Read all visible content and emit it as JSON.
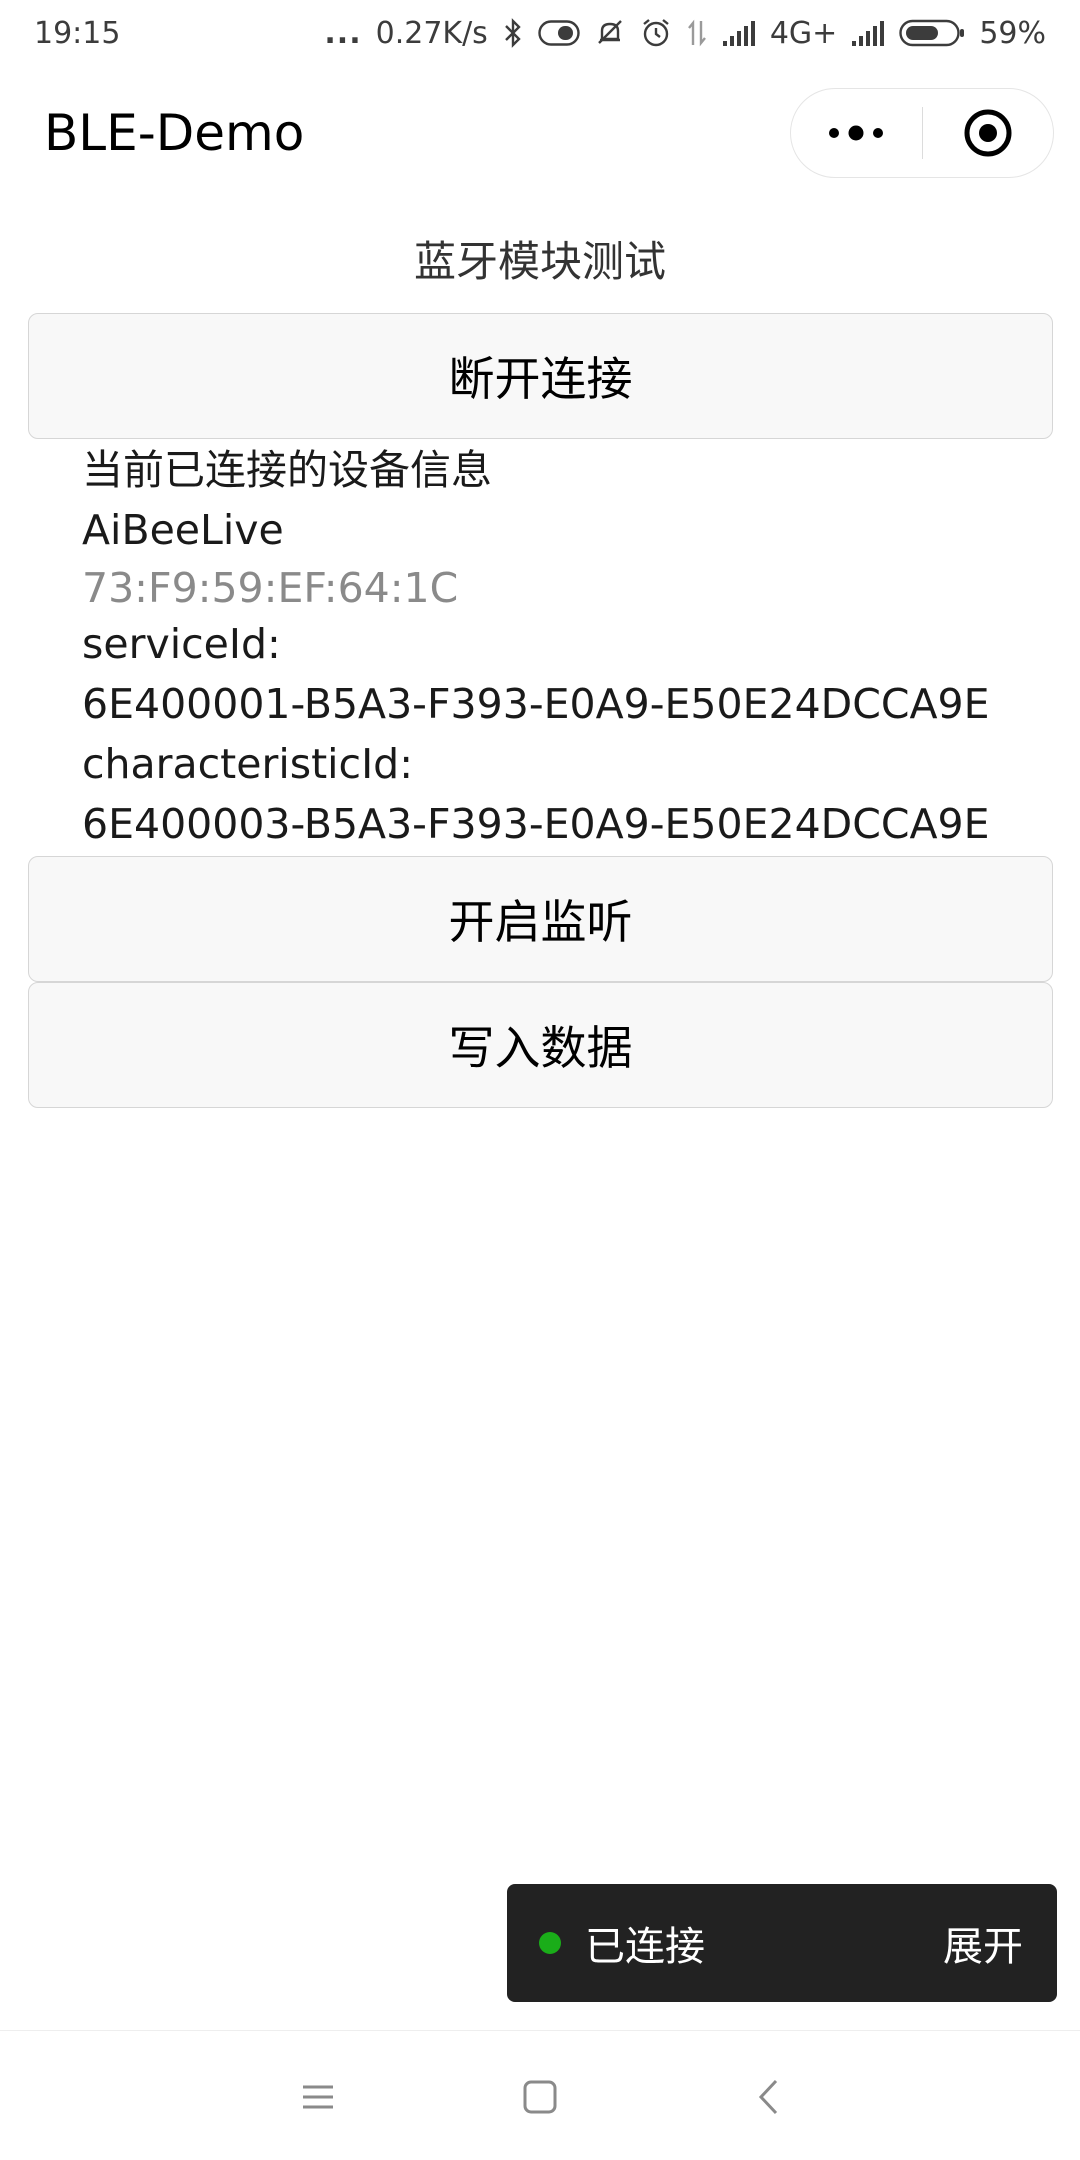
{
  "status_bar": {
    "time": "19:15",
    "more": "...",
    "net_speed": "0.27K/s",
    "network": "4G+",
    "battery": "59%",
    "icons": [
      "bluetooth-icon",
      "toggle-icon",
      "mute-icon",
      "alarm-icon",
      "data-transfer-icon",
      "signal-icon",
      "signal-icon",
      "battery-icon"
    ]
  },
  "nav": {
    "title": "BLE-Demo",
    "menu_icon": "more-dots-icon",
    "close_icon": "target-circle-icon"
  },
  "page": {
    "heading": "蓝牙模块测试",
    "disconnect_label": "断开连接",
    "listen_label": "开启监听",
    "write_label": "写入数据"
  },
  "device_info": {
    "title": "当前已连接的设备信息",
    "name": "AiBeeLive",
    "mac": "73:F9:59:EF:64:1C",
    "service_label": "serviceId:",
    "service_id": "6E400001-B5A3-F393-E0A9-E50E24DCCA9E",
    "characteristic_label": "characteristicId:",
    "characteristic_id": "6E400003-B5A3-F393-E0A9-E50E24DCCA9E"
  },
  "toast": {
    "status": "已连接",
    "action": "展开",
    "dot_color": "#1aad19"
  },
  "bottom_nav": {
    "icons": [
      "menu-icon",
      "home-icon",
      "back-icon"
    ]
  }
}
